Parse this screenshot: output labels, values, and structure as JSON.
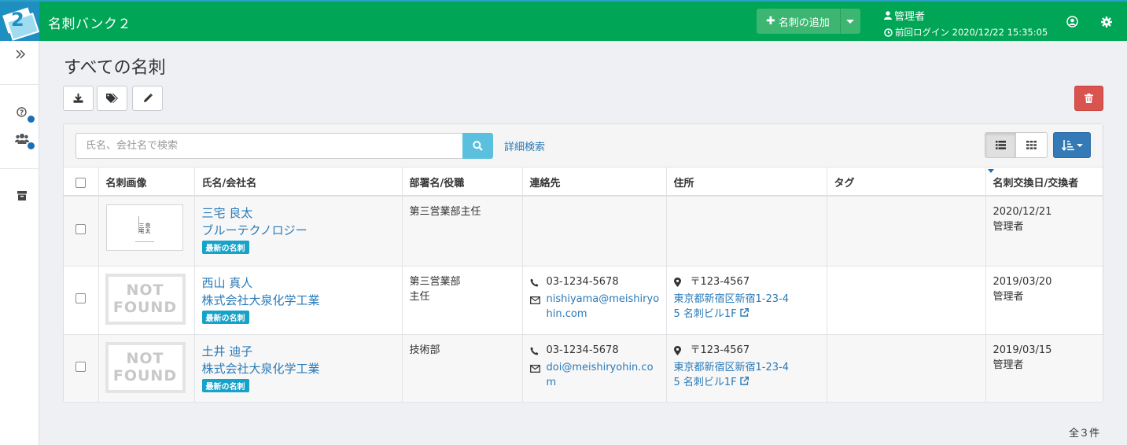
{
  "header": {
    "logo_text": "2",
    "app_title": "名刺バンク２",
    "add_button_label": "名刺の追加",
    "user_name": "管理者",
    "last_login": "前回ログイン 2020/12/22 15:35:05"
  },
  "page": {
    "title": "すべての名刺"
  },
  "search": {
    "placeholder": "氏名、会社名で検索",
    "advanced_link": "詳細検索"
  },
  "table": {
    "headers": [
      "名刺画像",
      "氏名/会社名",
      "部署名/役職",
      "連絡先",
      "住所",
      "タグ",
      "名刺交換日/交換者"
    ],
    "rows": [
      {
        "card_image_lines": [
          "三宅",
          "良太"
        ],
        "name": "三宅 良太",
        "company": "ブルーテクノロジー",
        "badge": "最新の名刺",
        "dept_line1": "第三営業部主任",
        "dept_line2": "",
        "phone": "",
        "email_line1": "",
        "email_line2": "",
        "zip": "",
        "address_line1": "",
        "address_line2": "",
        "tag": "",
        "date": "2020/12/21",
        "exchanger": "管理者"
      },
      {
        "not_found_line1": "NOT",
        "not_found_line2": "FOUND",
        "name": "西山 真人",
        "company": "株式会社大泉化学工業",
        "badge": "最新の名刺",
        "dept_line1": "第三営業部",
        "dept_line2": "主任",
        "phone": "03-1234-5678",
        "email_line1": "nishiyama@meishiryo",
        "email_line2": "hin.com",
        "zip": "〒123-4567",
        "address_line1": "東京都新宿区新宿1-23-4",
        "address_line2": "5 名刺ビル1F",
        "tag": "",
        "date": "2019/03/20",
        "exchanger": "管理者"
      },
      {
        "not_found_line1": "NOT",
        "not_found_line2": "FOUND",
        "name": "土井 迪子",
        "company": "株式会社大泉化学工業",
        "badge": "最新の名刺",
        "dept_line1": "技術部",
        "dept_line2": "",
        "phone": "03-1234-5678",
        "email_line1": "doi@meishiryohin.co",
        "email_line2": "m",
        "zip": "〒123-4567",
        "address_line1": "東京都新宿区新宿1-23-4",
        "address_line2": "5 名刺ビル1F",
        "tag": "",
        "date": "2019/03/15",
        "exchanger": "管理者"
      }
    ]
  },
  "footer": {
    "total": "全３件"
  },
  "icons": {
    "colors": {
      "header": "#00a655",
      "add_button": "#3cb671",
      "link": "#2a7ab8",
      "badge": "#17a2c9",
      "delete": "#d9534f",
      "sort": "#337ab7",
      "search": "#5bc0de"
    }
  }
}
